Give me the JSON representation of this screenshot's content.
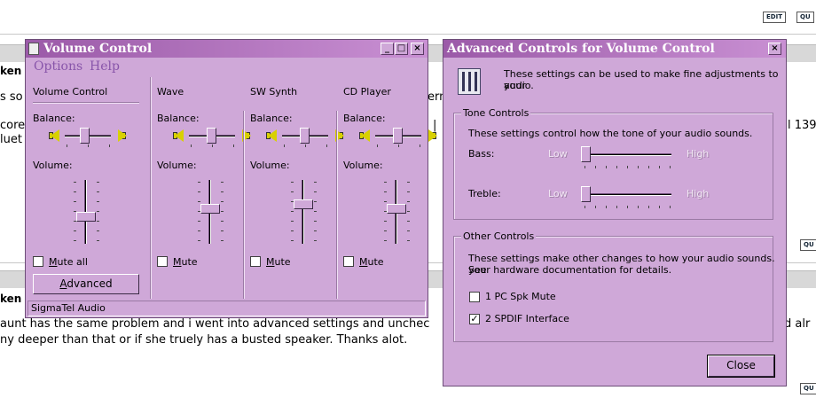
{
  "forum": {
    "edit_label": "EDIT",
    "quote_label": "QU",
    "bold_left_1": "ken",
    "bold_left_2": "ken",
    "snip_1": "s so",
    "snip_2": "core",
    "snip_3": "luet",
    "snip_ern": "ern",
    "snip_139": "l 139",
    "snip_alr": "ed alr",
    "post_line1": " aunt has the same problem and i went into advanced settings and unchec",
    "post_line2": "ny deeper than that or if she truely has a busted speaker. Thanks alot."
  },
  "volume_window": {
    "title": "Volume Control",
    "menu": [
      "Options",
      "Help"
    ],
    "channels": [
      {
        "name": "Volume Control",
        "balance_label": "Balance:",
        "volume_label": "Volume:",
        "mute_label": "Mute all",
        "muted": false,
        "balance": 0.45,
        "volume": 0.4
      },
      {
        "name": "Wave",
        "balance_label": "Balance:",
        "volume_label": "Volume:",
        "mute_label": "Mute",
        "muted": false,
        "balance": 0.5,
        "volume": 0.55
      },
      {
        "name": "SW Synth",
        "balance_label": "Balance:",
        "volume_label": "Volume:",
        "mute_label": "Mute",
        "muted": false,
        "balance": 0.5,
        "volume": 0.62
      },
      {
        "name": "CD Player",
        "balance_label": "Balance:",
        "volume_label": "Volume:",
        "mute_label": "Mute",
        "muted": false,
        "balance": 0.5,
        "volume": 0.55
      }
    ],
    "advanced_button": "Advanced",
    "status": "SigmaTel Audio",
    "controls": {
      "minimize": "_",
      "maximize": "□",
      "close": "×"
    }
  },
  "advanced_window": {
    "title": "Advanced Controls for Volume Control",
    "close": "×",
    "intro": [
      "These settings can be used to make fine adjustments to your",
      "audio."
    ],
    "tone_group": "Tone Controls",
    "tone_desc": "These settings control how the tone of your audio sounds.",
    "bass_label": "Bass:",
    "treble_label": "Treble:",
    "low_label": "Low",
    "high_label": "High",
    "bass_value": 0,
    "treble_value": 0,
    "other_group": "Other Controls",
    "other_desc": [
      "These settings make other changes to how your audio sounds.  See",
      "your hardware documentation for details."
    ],
    "options": [
      {
        "label": "1  PC Spk Mute",
        "checked": false
      },
      {
        "label": "2  SPDIF Interface",
        "checked": true
      }
    ],
    "close_button": "Close"
  }
}
